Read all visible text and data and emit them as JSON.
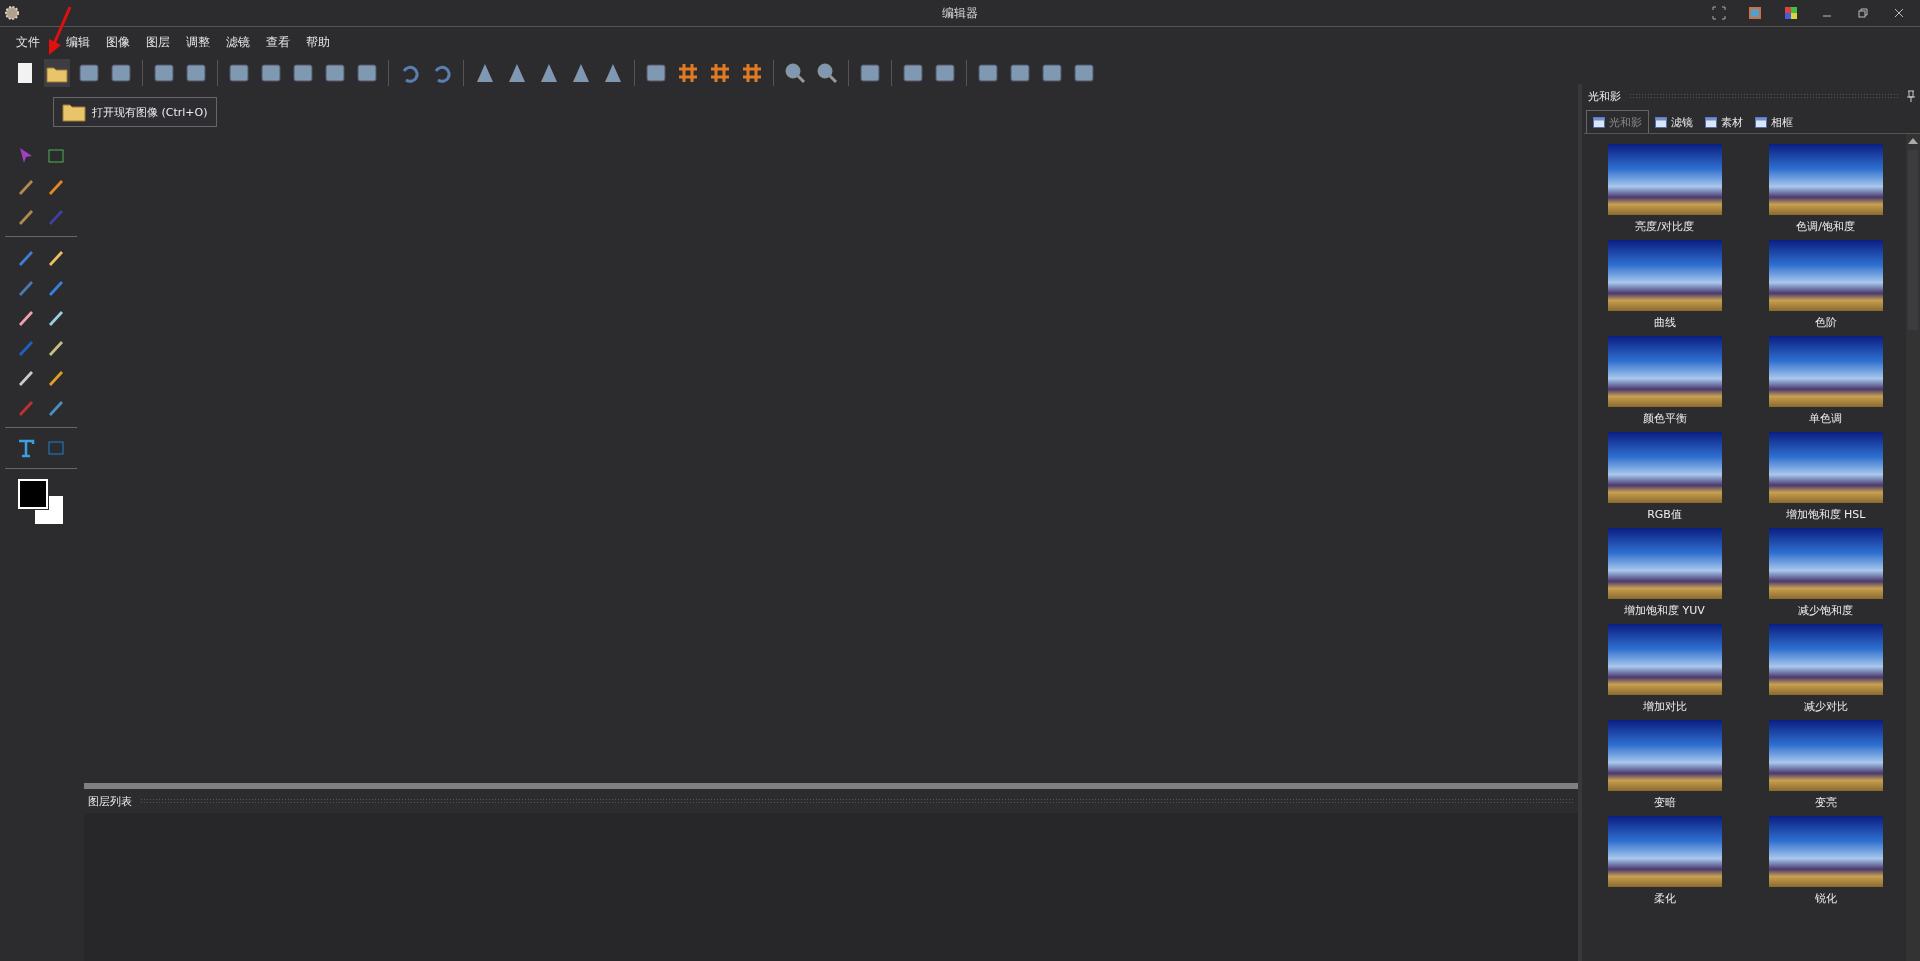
{
  "window": {
    "title": "编辑器"
  },
  "menu": [
    "文件",
    "编辑",
    "图像",
    "图层",
    "调整",
    "滤镜",
    "查看",
    "帮助"
  ],
  "tooltip": {
    "text": "打开现有图像 (Ctrl+O)"
  },
  "effects_panel": {
    "title": "光和影",
    "tabs": [
      {
        "label": "光和影",
        "selected": true
      },
      {
        "label": "滤镜",
        "selected": false
      },
      {
        "label": "素材",
        "selected": false
      },
      {
        "label": "相框",
        "selected": false
      }
    ],
    "items": [
      "亮度/对比度",
      "色调/饱和度",
      "曲线",
      "色阶",
      "颜色平衡",
      "单色调",
      "RGB值",
      "增加饱和度 HSL",
      "增加饱和度 YUV",
      "减少饱和度",
      "增加对比",
      "减少对比",
      "变暗",
      "变亮",
      "柔化",
      "锐化"
    ]
  },
  "layers_panel": {
    "title": "图层列表"
  }
}
